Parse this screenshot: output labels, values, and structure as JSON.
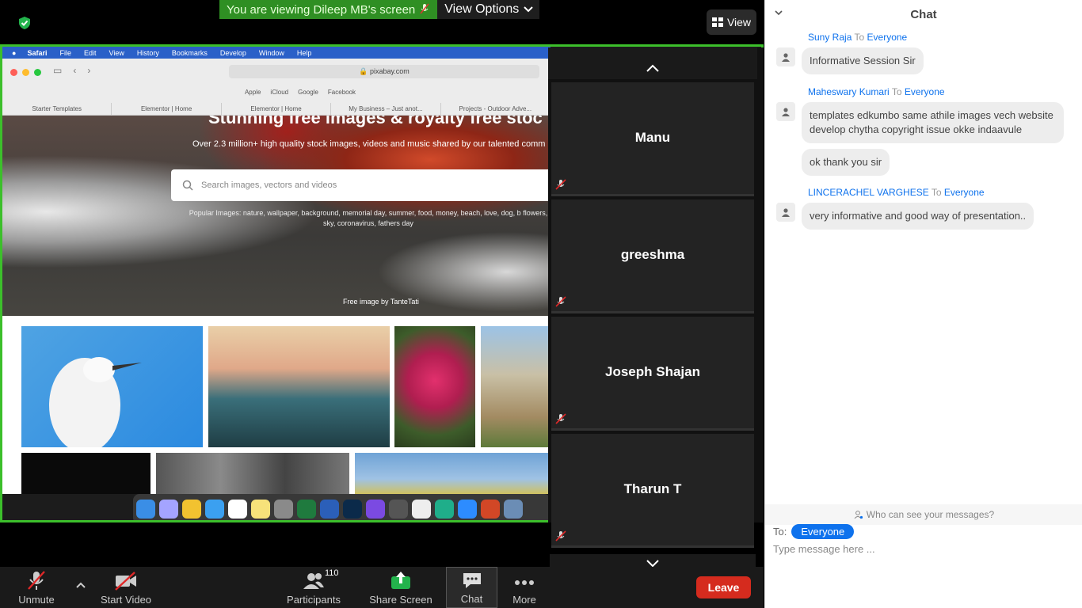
{
  "banner": {
    "viewing_text": "You are viewing Dileep MB's screen",
    "view_options": "View Options"
  },
  "view_button": "View",
  "shared_screen": {
    "mac_menu": [
      "Safari",
      "File",
      "Edit",
      "View",
      "History",
      "Bookmarks",
      "Develop",
      "Window",
      "Help"
    ],
    "url": "pixabay.com",
    "favorites": [
      "Apple",
      "iCloud",
      "Google",
      "Facebook"
    ],
    "tabs": [
      "Starter Templates",
      "Elementor | Home",
      "Elementor | Home",
      "My Business – Just anot...",
      "Projects - Outdoor Adve..."
    ],
    "hero_title": "Stunning free images & royalty free stoc",
    "hero_sub": "Over 2.3 million+ high quality stock images, videos and music shared by our talented comm",
    "search_placeholder": "Search images, vectors and videos",
    "popular": "Popular Images: nature, wallpaper, background, memorial day, summer, food, money, beach, love, dog, b flowers, sky, coronavirus, fathers day",
    "credit": "Free image by TanteTati"
  },
  "participants": [
    {
      "name": "Manu"
    },
    {
      "name": "greeshma"
    },
    {
      "name": "Joseph Shajan"
    },
    {
      "name": "Tharun T"
    }
  ],
  "toolbar": {
    "unmute": "Unmute",
    "start_video": "Start Video",
    "participants": "Participants",
    "participants_count": "110",
    "share_screen": "Share Screen",
    "chat": "Chat",
    "more": "More",
    "leave": "Leave"
  },
  "chat": {
    "title": "Chat",
    "to_word": "To",
    "messages": [
      {
        "sender": "Suny Raja",
        "recipient": "Everyone",
        "texts": [
          "Informative Session Sir"
        ]
      },
      {
        "sender": "Maheswary Kumari",
        "recipient": "Everyone",
        "texts": [
          "templates edkumbo same athile images vech website develop chytha copyright issue okke indaavule",
          "ok thank you sir"
        ]
      },
      {
        "sender": "LINCERACHEL VARGHESE",
        "recipient": "Everyone",
        "texts": [
          "very informative and good way of presentation.."
        ]
      }
    ],
    "who_can_see": "Who can see your messages?",
    "to_label": "To:",
    "to_value": "Everyone",
    "input_placeholder": "Type message here ..."
  },
  "colors": {
    "accent_green": "#3cbf2b",
    "zoom_blue": "#0e72ed",
    "leave_red": "#d52b1e"
  }
}
